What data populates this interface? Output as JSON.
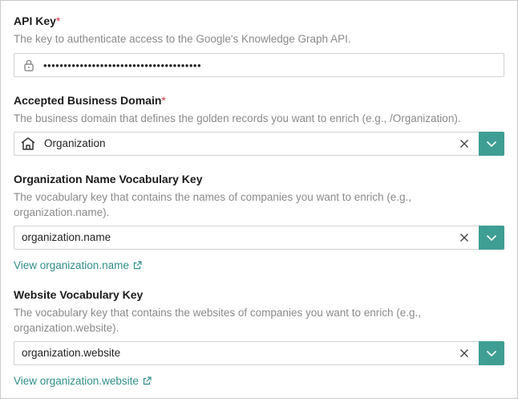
{
  "api_key": {
    "label": "API Key",
    "required_mark": "*",
    "help": "The key to authenticate access to the Google's Knowledge Graph API.",
    "value": "•••••••••••••••••••••••••••••••••••••••"
  },
  "business_domain": {
    "label": "Accepted Business Domain",
    "required_mark": "*",
    "help": "The business domain that defines the golden records you want to enrich (e.g., /Organization).",
    "value": "Organization"
  },
  "org_name_key": {
    "label": "Organization Name Vocabulary Key",
    "help_line1": "The vocabulary key that contains the names of companies you want to enrich (e.g.,",
    "help_line2": "organization.name).",
    "value": "organization.name",
    "link": "View organization.name"
  },
  "website_key": {
    "label": "Website Vocabulary Key",
    "help_line1": "The vocabulary key that contains the websites of companies you want to enrich (e.g.,",
    "help_line2": "organization.website).",
    "value": "organization.website",
    "link": "View organization.website"
  },
  "colors": {
    "accent": "#3f9e93",
    "link": "#2f8f86",
    "required": "#d6344a",
    "help_text": "#8a8a8a",
    "border": "#d2d2d2"
  },
  "icons": {
    "password": "lock-icon",
    "domain": "home-icon",
    "clear": "clear-icon",
    "dropdown": "chevron-down-icon",
    "external": "external-link-icon"
  }
}
